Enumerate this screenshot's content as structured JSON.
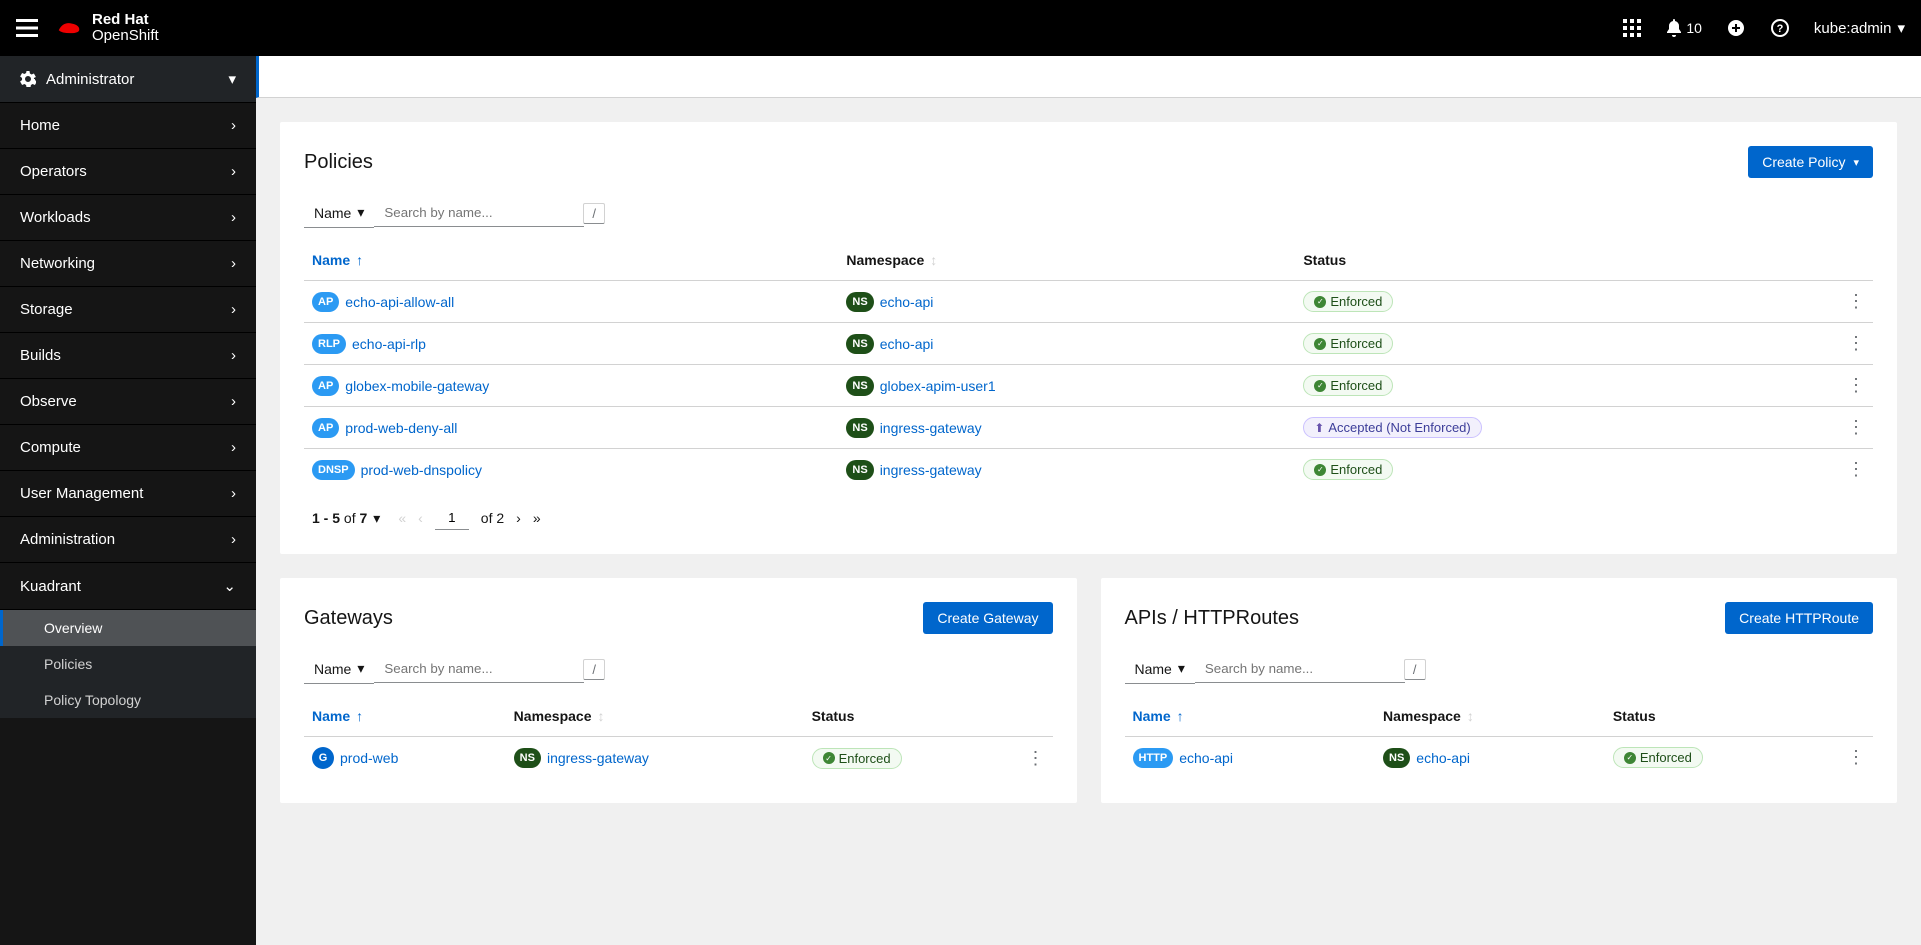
{
  "brand": {
    "top": "Red Hat",
    "bot": "OpenShift"
  },
  "header": {
    "notification_count": "10",
    "user": "kube:admin"
  },
  "sidebar": {
    "perspective": "Administrator",
    "items": [
      "Home",
      "Operators",
      "Workloads",
      "Networking",
      "Storage",
      "Builds",
      "Observe",
      "Compute",
      "User Management",
      "Administration"
    ],
    "kuadrant": {
      "label": "Kuadrant",
      "children": [
        "Overview",
        "Policies",
        "Policy Topology"
      ]
    }
  },
  "filter": {
    "mode": "Name",
    "placeholder": "Search by name...",
    "slash": "/"
  },
  "columns": {
    "name": "Name",
    "namespace": "Namespace",
    "status": "Status"
  },
  "policies": {
    "title": "Policies",
    "create": "Create Policy",
    "rows": [
      {
        "badge": "AP",
        "bclass": "ap",
        "name": "echo-api-allow-all",
        "ns": "echo-api",
        "status": "enforced"
      },
      {
        "badge": "RLP",
        "bclass": "rlp",
        "name": "echo-api-rlp",
        "ns": "echo-api",
        "status": "enforced"
      },
      {
        "badge": "AP",
        "bclass": "ap",
        "name": "globex-mobile-gateway",
        "ns": "globex-apim-user1",
        "status": "enforced"
      },
      {
        "badge": "AP",
        "bclass": "ap",
        "name": "prod-web-deny-all",
        "ns": "ingress-gateway",
        "status": "accepted"
      },
      {
        "badge": "DNSP",
        "bclass": "dnsp",
        "name": "prod-web-dnspolicy",
        "ns": "ingress-gateway",
        "status": "enforced"
      }
    ],
    "pager": {
      "range": "1 - 5",
      "of_word": "of",
      "total": "7",
      "page": "1",
      "pages": "2"
    }
  },
  "status_labels": {
    "enforced": "Enforced",
    "accepted": "Accepted (Not Enforced)"
  },
  "gateways": {
    "title": "Gateways",
    "create": "Create Gateway",
    "rows": [
      {
        "badge": "G",
        "bclass": "g",
        "name": "prod-web",
        "ns": "ingress-gateway",
        "status": "enforced"
      }
    ]
  },
  "httproutes": {
    "title": "APIs / HTTPRoutes",
    "create": "Create HTTPRoute",
    "rows": [
      {
        "badge": "HTTP",
        "bclass": "http",
        "name": "echo-api",
        "ns": "echo-api",
        "status": "enforced"
      }
    ]
  }
}
